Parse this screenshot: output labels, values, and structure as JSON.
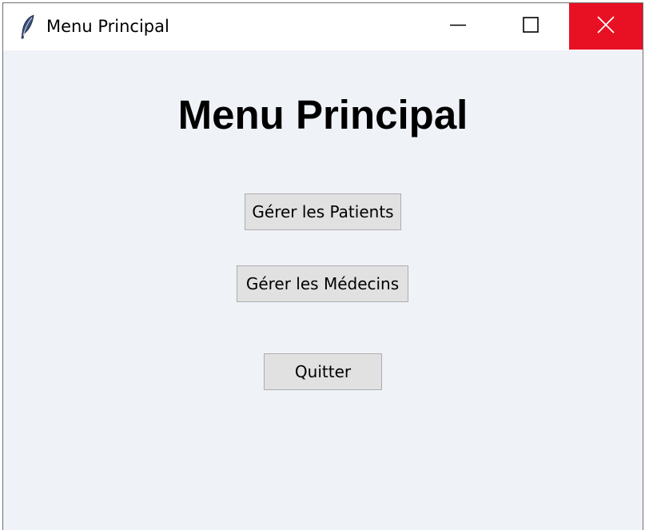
{
  "window": {
    "title": "Menu Principal",
    "app_icon": "feather-icon",
    "controls": {
      "minimize_icon": "minimize-icon",
      "maximize_icon": "maximize-icon",
      "close_icon": "close-icon",
      "close_hover_color": "#e81123"
    }
  },
  "main": {
    "heading": "Menu Principal",
    "buttons": {
      "patients": "Gérer les Patients",
      "medecins": "Gérer les Médecins",
      "quit": "Quitter"
    }
  },
  "colors": {
    "background": "#eff2f7",
    "button_face": "#e1e1e1",
    "button_border": "#adadad"
  }
}
